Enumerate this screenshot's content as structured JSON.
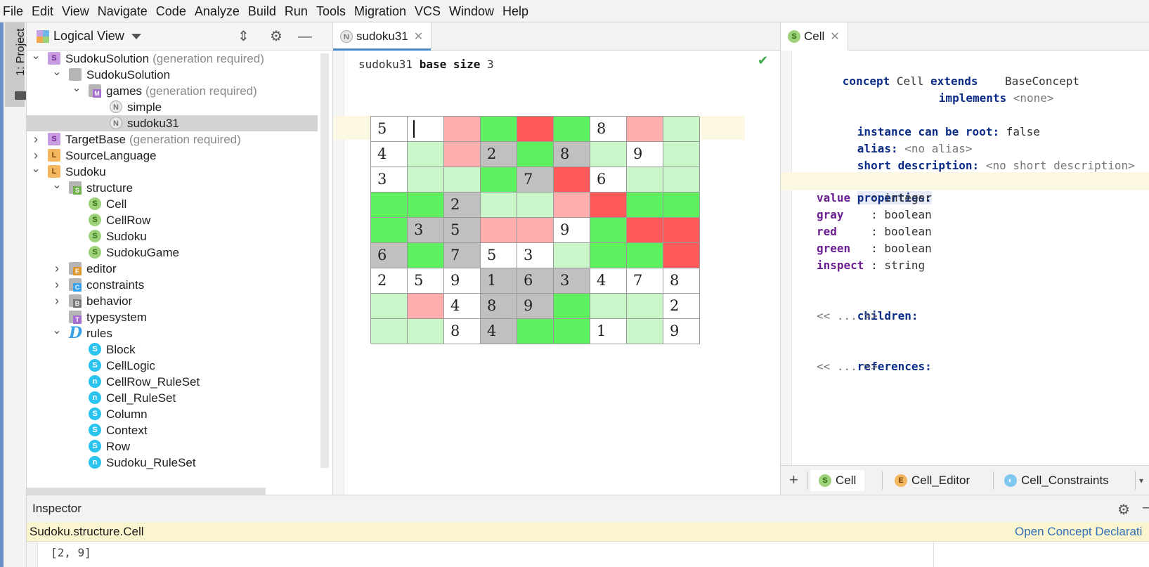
{
  "menu": [
    "File",
    "Edit",
    "View",
    "Navigate",
    "Code",
    "Analyze",
    "Build",
    "Run",
    "Tools",
    "Migration",
    "VCS",
    "Window",
    "Help"
  ],
  "tool_stripe": {
    "project_tab": "1: Project"
  },
  "project_panel": {
    "title": "Logical View",
    "tree": [
      {
        "label": "SudokuSolution",
        "suffix": "(generation required)",
        "icon": "solution-icon",
        "expanded": true
      },
      {
        "label": "SudokuSolution",
        "suffix": "",
        "icon": "folder-icon",
        "expanded": true
      },
      {
        "label": "games",
        "suffix": "(generation required)",
        "icon": "model-folder-icon",
        "expanded": true
      },
      {
        "label": "simple",
        "suffix": "",
        "icon": "node-icon"
      },
      {
        "label": "sudoku31",
        "suffix": "",
        "icon": "node-icon",
        "selected": true
      },
      {
        "label": "TargetBase",
        "suffix": "(generation required)",
        "icon": "solution-icon",
        "expanded": false
      },
      {
        "label": "SourceLanguage",
        "suffix": "",
        "icon": "language-icon",
        "expanded": false
      },
      {
        "label": "Sudoku",
        "suffix": "",
        "icon": "language-icon",
        "expanded": true
      },
      {
        "label": "structure",
        "suffix": "",
        "icon": "structure-folder-icon",
        "expanded": true
      },
      {
        "label": "Cell",
        "suffix": "",
        "icon": "concept-icon"
      },
      {
        "label": "CellRow",
        "suffix": "",
        "icon": "concept-icon"
      },
      {
        "label": "Sudoku",
        "suffix": "",
        "icon": "concept-icon"
      },
      {
        "label": "SudokuGame",
        "suffix": "",
        "icon": "concept-icon"
      },
      {
        "label": "editor",
        "suffix": "",
        "icon": "editor-folder-icon",
        "expanded": false
      },
      {
        "label": "constraints",
        "suffix": "",
        "icon": "constraints-folder-icon",
        "expanded": false
      },
      {
        "label": "behavior",
        "suffix": "",
        "icon": "behavior-folder-icon",
        "expanded": false
      },
      {
        "label": "typesystem",
        "suffix": "",
        "icon": "typesystem-folder-icon"
      },
      {
        "label": "rules",
        "suffix": "",
        "icon": "rules-icon",
        "expanded": true
      },
      {
        "label": "Block",
        "suffix": "",
        "icon": "rule-s-icon"
      },
      {
        "label": "CellLogic",
        "suffix": "",
        "icon": "rule-s-icon"
      },
      {
        "label": "CellRow_RuleSet",
        "suffix": "",
        "icon": "rule-n-icon"
      },
      {
        "label": "Cell_RuleSet",
        "suffix": "",
        "icon": "rule-n-icon"
      },
      {
        "label": "Column",
        "suffix": "",
        "icon": "rule-s-icon"
      },
      {
        "label": "Context",
        "suffix": "",
        "icon": "rule-s-icon"
      },
      {
        "label": "Row",
        "suffix": "",
        "icon": "rule-s-icon"
      },
      {
        "label": "Sudoku_RuleSet",
        "suffix": "",
        "icon": "rule-n-icon"
      }
    ]
  },
  "editor": {
    "tab_label": "sudoku31",
    "header": {
      "name": "sudoku31",
      "kw": "base size",
      "size": "3"
    },
    "grid": [
      [
        [
          "5",
          "w"
        ],
        [
          "",
          "w"
        ],
        [
          "",
          "p"
        ],
        [
          "",
          "g"
        ],
        [
          "",
          "r"
        ],
        [
          "",
          "g"
        ],
        [
          "8",
          "w"
        ],
        [
          "",
          "p"
        ],
        [
          "",
          "l"
        ]
      ],
      [
        [
          "4",
          "w"
        ],
        [
          "",
          "l"
        ],
        [
          "",
          "p"
        ],
        [
          "2",
          "y"
        ],
        [
          "",
          "g"
        ],
        [
          "8",
          "y"
        ],
        [
          "",
          "l"
        ],
        [
          "9",
          "w"
        ],
        [
          "",
          "l"
        ]
      ],
      [
        [
          "3",
          "w"
        ],
        [
          "",
          "l"
        ],
        [
          "",
          "l"
        ],
        [
          "",
          "g"
        ],
        [
          "7",
          "y"
        ],
        [
          "",
          "r"
        ],
        [
          "6",
          "w"
        ],
        [
          "",
          "l"
        ],
        [
          "",
          "l"
        ]
      ],
      [
        [
          "",
          "g"
        ],
        [
          "",
          "g"
        ],
        [
          "2",
          "y"
        ],
        [
          "",
          "l"
        ],
        [
          "",
          "l"
        ],
        [
          "",
          "p"
        ],
        [
          "",
          "r"
        ],
        [
          "",
          "g"
        ],
        [
          "",
          "g"
        ]
      ],
      [
        [
          "",
          "g"
        ],
        [
          "3",
          "y"
        ],
        [
          "5",
          "y"
        ],
        [
          "",
          "p"
        ],
        [
          "",
          "p"
        ],
        [
          "9",
          "w"
        ],
        [
          "",
          "g"
        ],
        [
          "",
          "r"
        ],
        [
          "",
          "r"
        ]
      ],
      [
        [
          "6",
          "y"
        ],
        [
          "",
          "g"
        ],
        [
          "7",
          "y"
        ],
        [
          "5",
          "w"
        ],
        [
          "3",
          "w"
        ],
        [
          "",
          "l"
        ],
        [
          "",
          "g"
        ],
        [
          "",
          "g"
        ],
        [
          "",
          "r"
        ]
      ],
      [
        [
          "2",
          "w"
        ],
        [
          "5",
          "w"
        ],
        [
          "9",
          "w"
        ],
        [
          "1",
          "y"
        ],
        [
          "6",
          "y"
        ],
        [
          "3",
          "y"
        ],
        [
          "4",
          "w"
        ],
        [
          "7",
          "w"
        ],
        [
          "8",
          "w"
        ]
      ],
      [
        [
          "",
          "l"
        ],
        [
          "",
          "p"
        ],
        [
          "4",
          "w"
        ],
        [
          "8",
          "y"
        ],
        [
          "9",
          "y"
        ],
        [
          "",
          "g"
        ],
        [
          "",
          "l"
        ],
        [
          "",
          "l"
        ],
        [
          "2",
          "w"
        ]
      ],
      [
        [
          "",
          "l"
        ],
        [
          "",
          "l"
        ],
        [
          "8",
          "w"
        ],
        [
          "4",
          "y"
        ],
        [
          "",
          "g"
        ],
        [
          "",
          "g"
        ],
        [
          "1",
          "w"
        ],
        [
          "",
          "l"
        ],
        [
          "9",
          "w"
        ]
      ]
    ]
  },
  "concept": {
    "tab_label": "Cell",
    "lines": {
      "concept_kw": "concept",
      "name": "Cell",
      "extends_kw": "extends",
      "extends_val": "BaseConcept",
      "implements_kw": "implements",
      "implements_val": "<none>",
      "root_kw": "instance can be root:",
      "root_val": "false",
      "alias_kw": "alias:",
      "alias_val": "<no alias>",
      "short_kw": "short description:",
      "short_val": "<no short description>",
      "props_kw": "properties:",
      "props": [
        {
          "name": "value  ",
          "type": ": integer"
        },
        {
          "name": "gray   ",
          "type": ": boolean"
        },
        {
          "name": "red    ",
          "type": ": boolean"
        },
        {
          "name": "green  ",
          "type": ": boolean"
        },
        {
          "name": "inspect",
          "type": ": string"
        }
      ],
      "children_kw": "children:",
      "children_val": "<< ... >>",
      "refs_kw": "references:",
      "refs_val": "<< ... >>"
    },
    "bottom_tabs": [
      "Cell",
      "Cell_Editor",
      "Cell_Constraints"
    ]
  },
  "inspector": {
    "title": "Inspector",
    "concept": "Sudoku.structure.Cell",
    "open_link": "Open Concept Declarati",
    "value": "[2, 9]"
  }
}
